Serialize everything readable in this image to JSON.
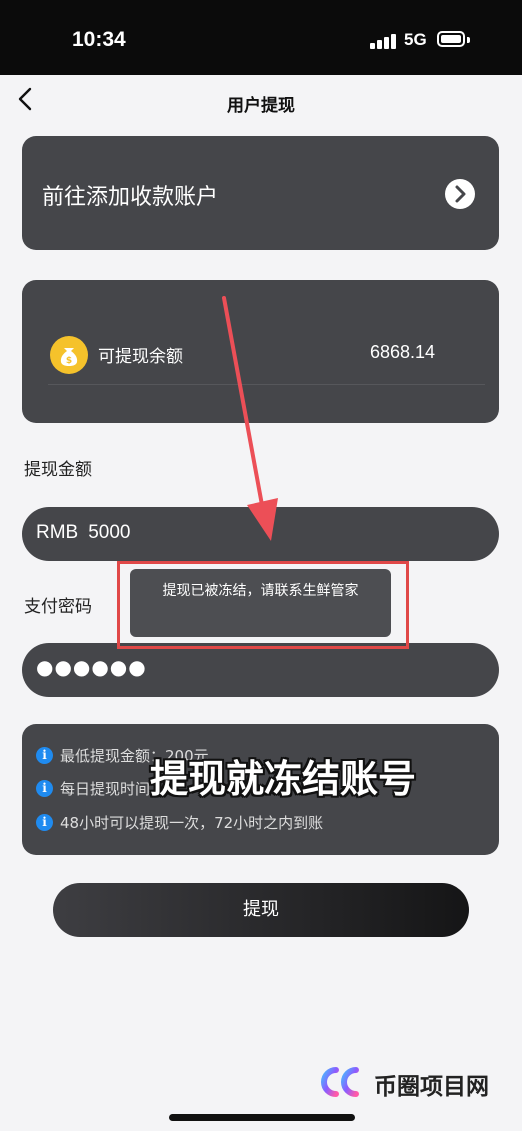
{
  "status_bar": {
    "time": "10:34",
    "network": "5G"
  },
  "nav": {
    "title": "用户提现"
  },
  "account_card": {
    "label": "前往添加收款账户"
  },
  "balance_card": {
    "label": "可提现余额",
    "value": "6868.14"
  },
  "amount_section": {
    "label": "提现金额",
    "currency": "RMB",
    "value": "5000"
  },
  "password_section": {
    "label": "支付密码",
    "masked_value": "●●●●●●"
  },
  "toast": {
    "message": "提现已被冻结，请联系生鲜管家"
  },
  "info": {
    "items": [
      {
        "text": "最低提现金额：200元"
      },
      {
        "text": "每日提现时间"
      },
      {
        "text": "48小时可以提现一次，72小时之内到账"
      }
    ]
  },
  "overlay_caption": "提现就冻结账号",
  "submit_label": "提现",
  "watermark": {
    "text": "币圈项目网"
  },
  "colors": {
    "card": "#45464a",
    "highlight": "#e04848",
    "info_icon": "#1f8bf0",
    "coin": "#f5c22b"
  },
  "icons": [
    "back-chevron-icon",
    "chevron-right-icon",
    "money-bag-icon",
    "info-icon"
  ]
}
